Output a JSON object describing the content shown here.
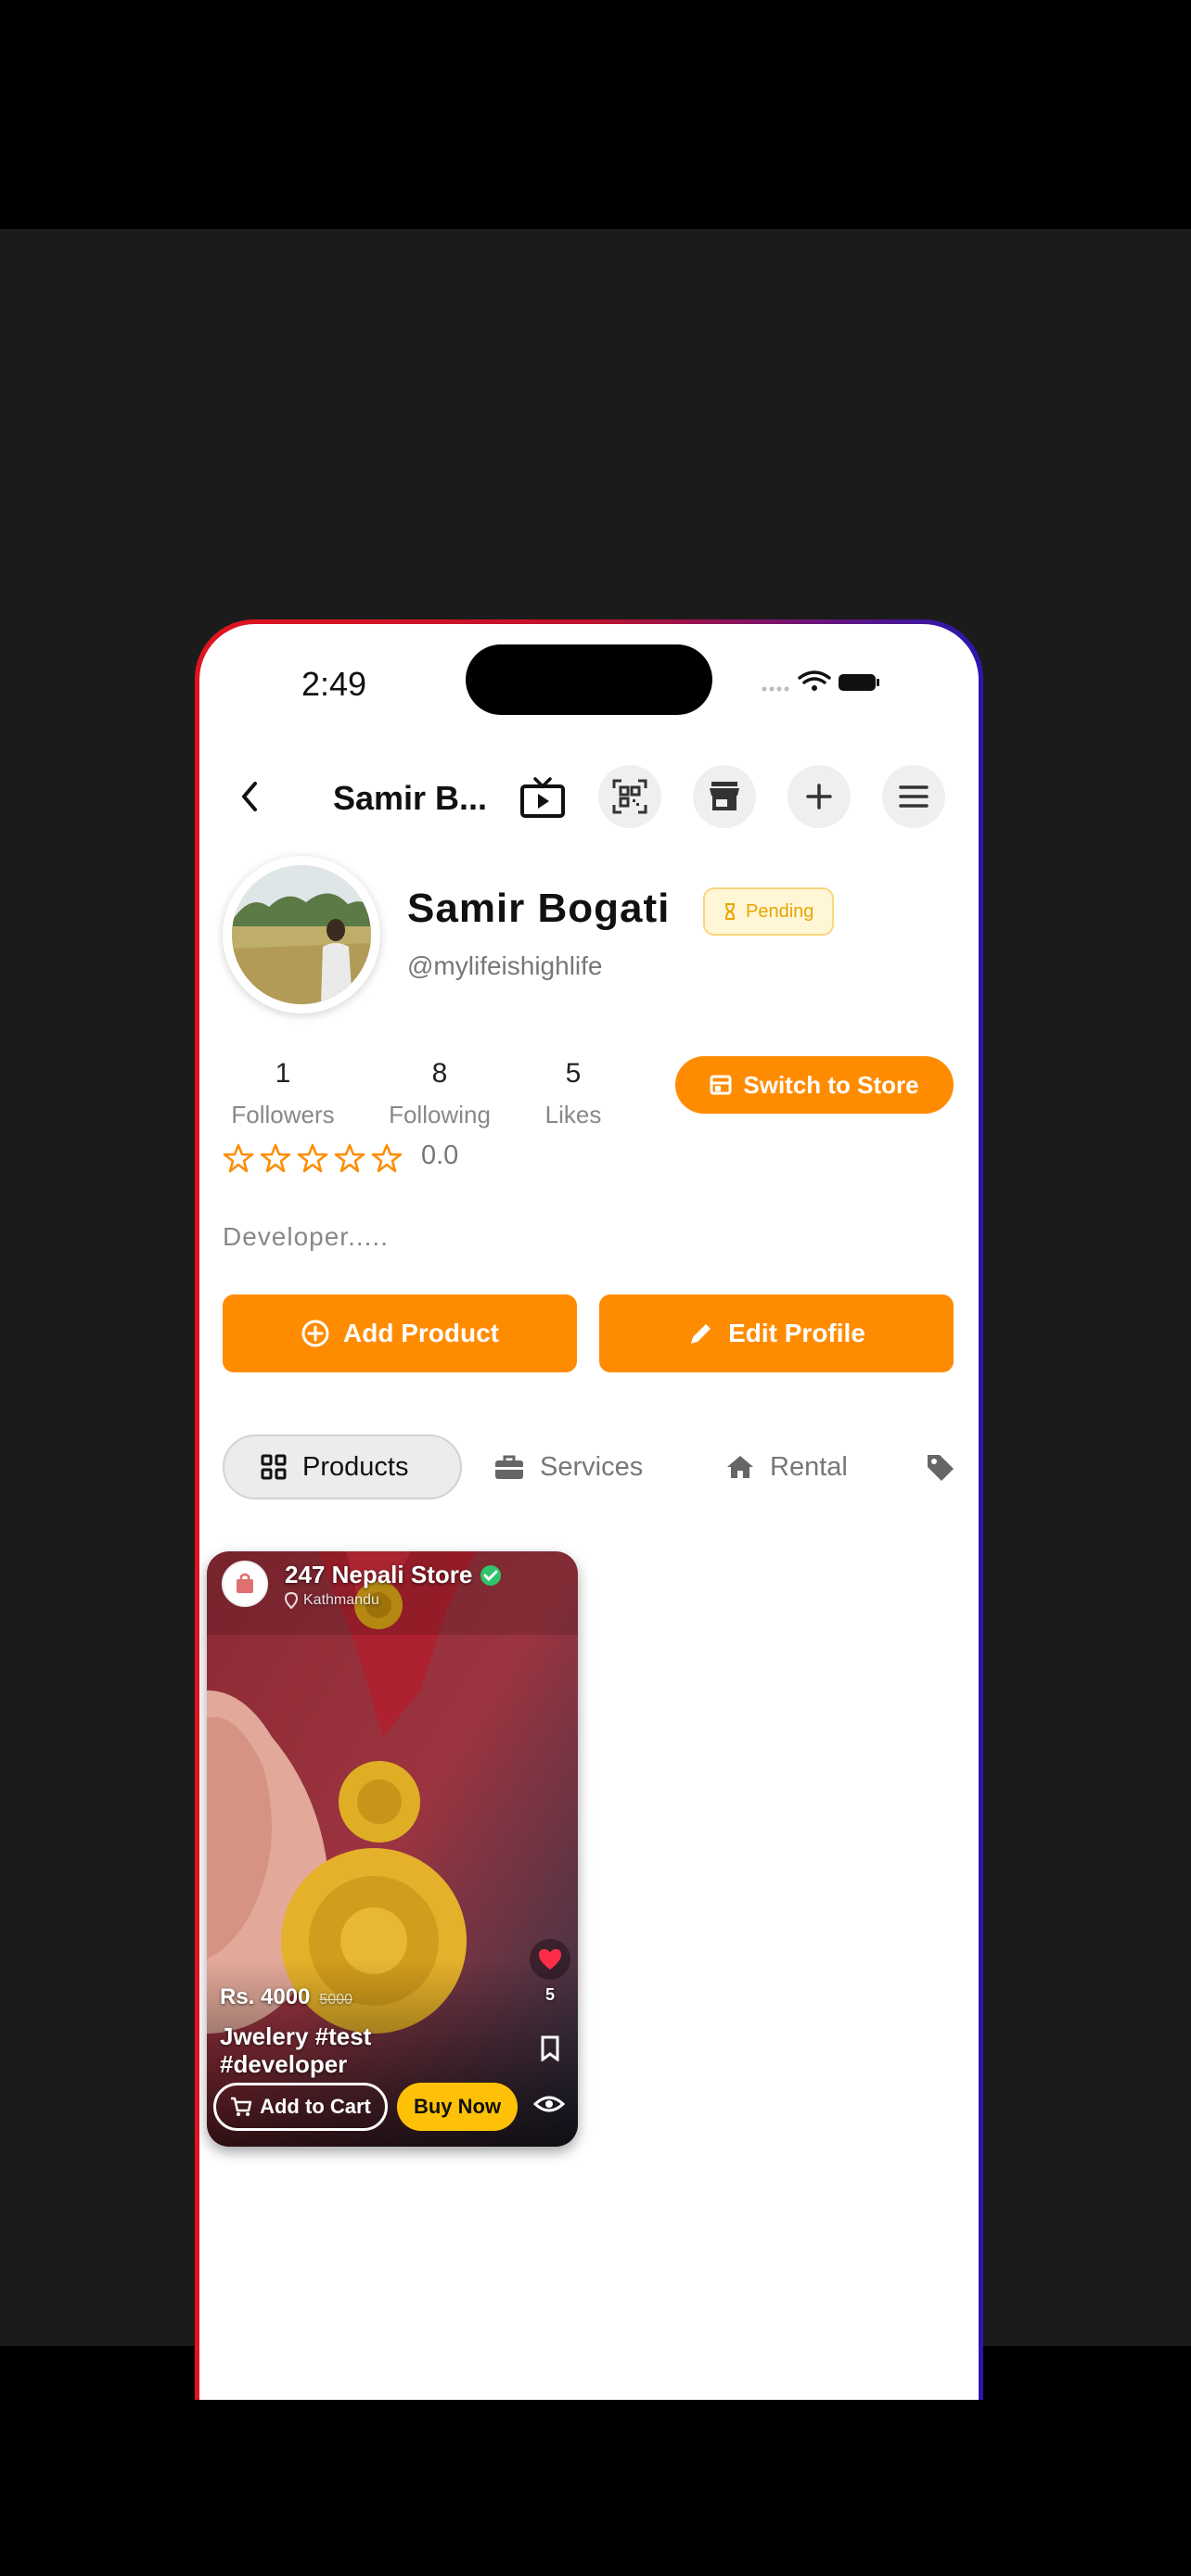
{
  "status_bar": {
    "time": "2:49"
  },
  "top_bar": {
    "title": "Samir B..."
  },
  "profile": {
    "name": "Samir Bogati",
    "badge": "Pending",
    "handle": "@mylifeishighlife",
    "bio": "Developer.....",
    "rating": "0.0",
    "rating_stars": 0
  },
  "stats": [
    {
      "value": "1",
      "label": "Followers"
    },
    {
      "value": "8",
      "label": "Following"
    },
    {
      "value": "5",
      "label": "Likes"
    }
  ],
  "buttons": {
    "switch_store": "Switch to Store",
    "add_product": "Add Product",
    "edit_profile": "Edit Profile"
  },
  "tabs": [
    {
      "label": "Products"
    },
    {
      "label": "Services"
    },
    {
      "label": "Rental"
    }
  ],
  "product_card": {
    "store_name": "247 Nepali Store",
    "location": "Kathmandu",
    "price": "Rs. 4000",
    "old_price": "5000",
    "title_line1": "Jwelery #test",
    "title_line2": "#developer",
    "like_count": "5",
    "add_to_cart": "Add to Cart",
    "buy_now": "Buy Now"
  },
  "colors": {
    "accent": "#ff8c00",
    "pending_text": "#e8a500",
    "buy_now": "#ffc107"
  }
}
